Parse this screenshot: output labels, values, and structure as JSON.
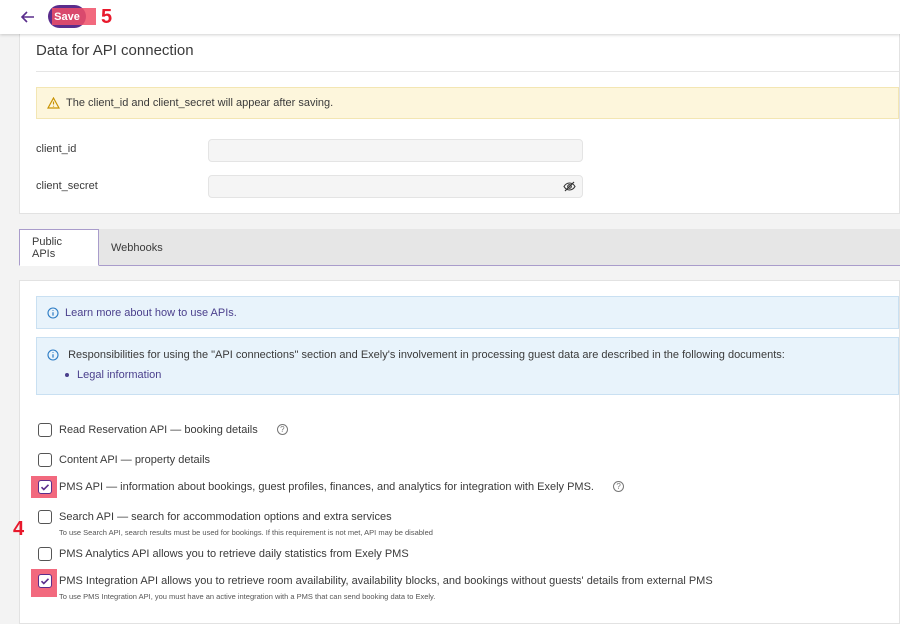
{
  "toolbar": {
    "back_icon": "arrow-left-icon",
    "save_label": "Save"
  },
  "annotations": {
    "save": "5",
    "checkbox": "4"
  },
  "api_connection": {
    "title": "Data for API connection",
    "warning": "The client_id and client_secret will appear after saving.",
    "client_id_label": "client_id",
    "client_id_value": "",
    "client_secret_label": "client_secret",
    "client_secret_value": ""
  },
  "tabs": [
    {
      "label": "Public APIs",
      "active": true
    },
    {
      "label": "Webhooks",
      "active": false
    }
  ],
  "info": {
    "learn_more": "Learn more about how to use APIs.",
    "responsibilities": "Responsibilities for using the \"API connections\" section and Exely's involvement in processing guest data are described in the following documents:",
    "legal_link": "Legal information"
  },
  "apis": [
    {
      "label": "Read Reservation API — booking details",
      "checked": false,
      "help": true,
      "note": ""
    },
    {
      "label": "Content API — property details",
      "checked": false,
      "help": false,
      "note": ""
    },
    {
      "label": "PMS API — information about bookings, guest profiles, finances, and analytics for integration with Exely PMS.",
      "checked": true,
      "help": true,
      "note": ""
    },
    {
      "label": "Search API — search for accommodation options and extra services",
      "checked": false,
      "help": false,
      "note": "To use Search API, search results must be used for bookings. If this requirement is not met, API may be disabled"
    },
    {
      "label": "PMS Analytics API allows you to retrieve daily statistics from Exely PMS",
      "checked": false,
      "help": false,
      "note": ""
    },
    {
      "label": "PMS Integration API allows you to retrieve room availability, availability blocks, and bookings without guests' details from external PMS",
      "checked": true,
      "help": false,
      "note": "To use PMS Integration API, you must have an active integration with a PMS that can send booking data to Exely."
    }
  ],
  "colors": {
    "accent": "#5a2d8c",
    "highlight": "#f04f67",
    "annotation": "#e8192c"
  }
}
